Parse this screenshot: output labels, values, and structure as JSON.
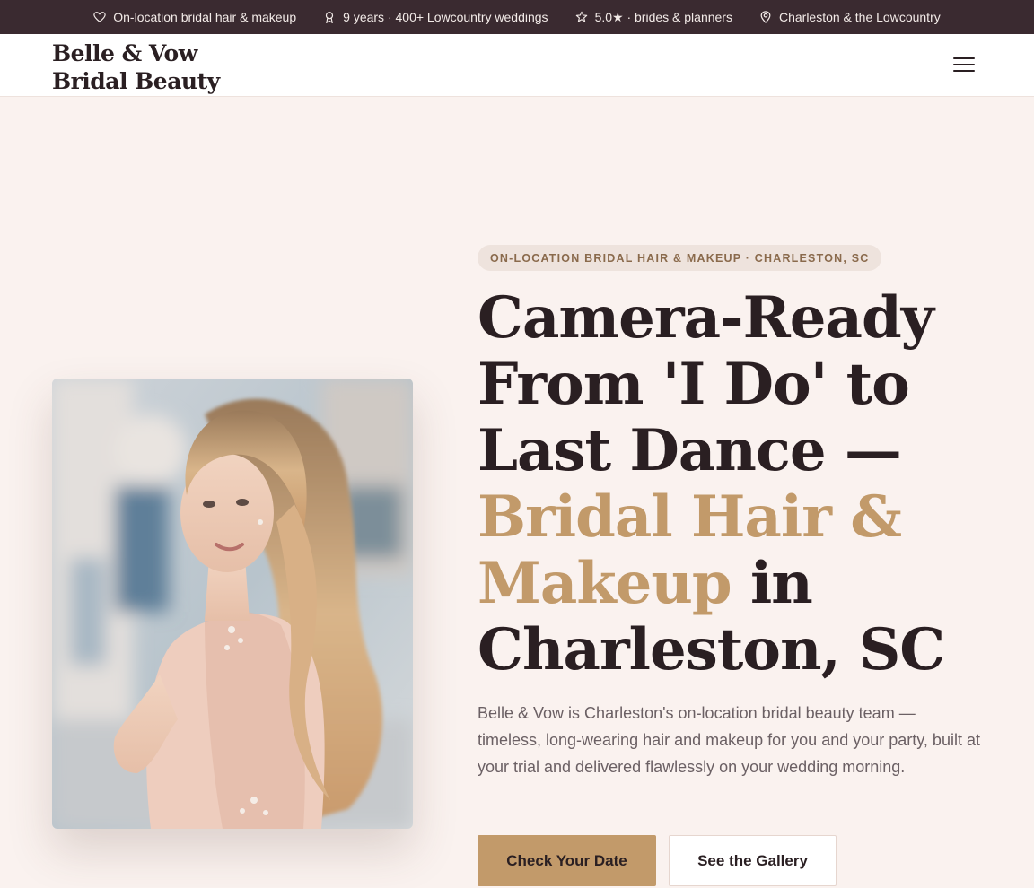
{
  "topbar": {
    "items": [
      {
        "icon": "heart-icon",
        "label": "On-location bridal hair & makeup"
      },
      {
        "icon": "award-icon",
        "label": "9 years · 400+ Lowcountry weddings"
      },
      {
        "icon": "star-icon",
        "label": "5.0★ · brides & planners"
      },
      {
        "icon": "map-pin-icon",
        "label": "Charleston & the Lowcountry"
      }
    ]
  },
  "nav": {
    "logo_line1": "Belle & Vow",
    "logo_line2": "Bridal Beauty",
    "menu_icon": "hamburger-menu-icon"
  },
  "hero": {
    "eyebrow": "ON-LOCATION BRIDAL HAIR & MAKEUP · CHARLESTON, SC",
    "headline": {
      "line1": "Camera-Ready",
      "line2": "From 'I Do' to",
      "line3": "Last Dance —",
      "line4_accent": "Bridal Hair &",
      "line5_accent": "Makeup",
      "line5_rest": " in",
      "line6": "Charleston, SC"
    },
    "lead": "Belle & Vow is Charleston's on-location bridal beauty team — timeless, long-wearing hair and makeup for you and your party, built at your trial and delivered flawlessly on your wedding morning.",
    "primary_cta": "Check Your Date",
    "secondary_cta": "See the Gallery"
  },
  "colors": {
    "topbar_bg": "#3a2a30",
    "page_bg": "#faf2ef",
    "accent": "#c29a6a",
    "text_dark": "#2a1f22"
  }
}
